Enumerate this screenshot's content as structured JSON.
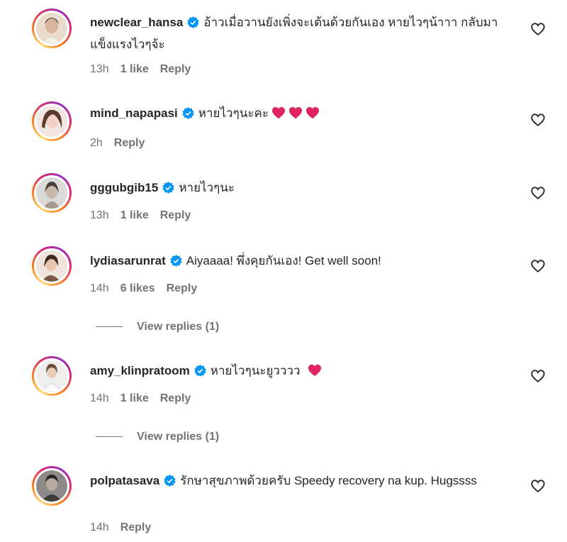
{
  "comments": [
    {
      "username": "newclear_hansa",
      "text": "อ้าวเมื่อวานยังเพิ่งจะเต้นด้วยกันเอง หายไวๆน้าาา กลับมาแข็งแรงไวๆจ้ะ",
      "time": "13h",
      "likes": "1 like",
      "reply": "Reply"
    },
    {
      "username": "mind_napapasi",
      "text": "หายไวๆนะคะ",
      "time": "2h",
      "likes": "",
      "reply": "Reply"
    },
    {
      "username": "gggubgib15",
      "text": "หายไวๆนะ",
      "time": "13h",
      "likes": "1 like",
      "reply": "Reply"
    },
    {
      "username": "lydiasarunrat",
      "text": "Aiyaaaa! พึ่งคุยกันเอง! Get well soon!",
      "time": "14h",
      "likes": "6 likes",
      "reply": "Reply",
      "view_replies": "View replies (1)"
    },
    {
      "username": "amy_klinpratoom",
      "text": "หายไวๆนะยูวววว",
      "time": "14h",
      "likes": "1 like",
      "reply": "Reply",
      "view_replies": "View replies (1)"
    },
    {
      "username": "polpatasava",
      "text": "รักษาสุขภาพด้วยครับ Speedy recovery na kup. Hugssss",
      "time": "14h",
      "likes": "",
      "reply": "Reply"
    }
  ],
  "icons": {
    "verified": "verified-badge-icon",
    "like": "heart-outline-icon",
    "emoji": "heart-emoji-icon"
  },
  "colors": {
    "verified_blue": "#0095f6",
    "meta_gray": "#737373",
    "heart_emoji": "#e0245e"
  }
}
